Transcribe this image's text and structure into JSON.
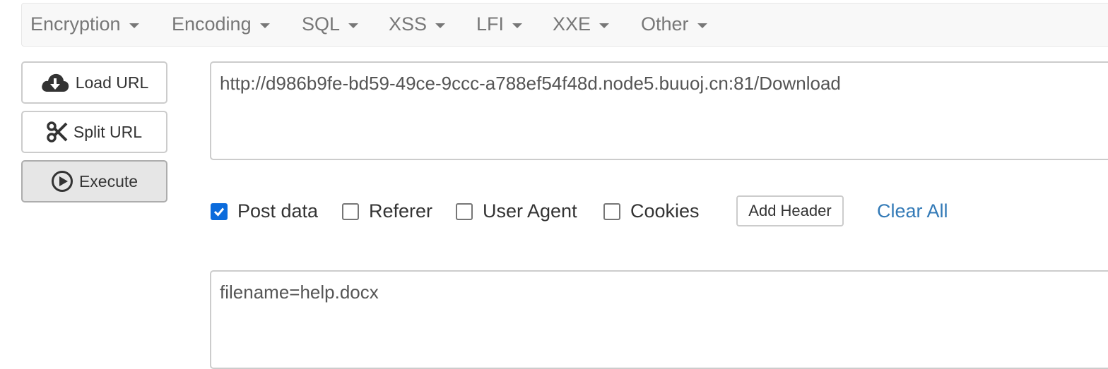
{
  "menu": {
    "items": [
      {
        "label": "Encryption"
      },
      {
        "label": "Encoding"
      },
      {
        "label": "SQL"
      },
      {
        "label": "XSS"
      },
      {
        "label": "LFI"
      },
      {
        "label": "XXE"
      },
      {
        "label": "Other"
      }
    ]
  },
  "sidebar": {
    "load_url_label": "Load URL",
    "split_url_label": "Split URL",
    "execute_label": "Execute"
  },
  "url_input": {
    "value": "http://d986b9fe-bd59-49ce-9ccc-a788ef54f48d.node5.buuoj.cn:81/Download"
  },
  "options": {
    "post_data": {
      "label": "Post data",
      "checked": true
    },
    "referer": {
      "label": "Referer",
      "checked": false
    },
    "user_agent": {
      "label": "User Agent",
      "checked": false
    },
    "cookies": {
      "label": "Cookies",
      "checked": false
    },
    "add_header_label": "Add Header",
    "clear_all_label": "Clear All"
  },
  "post_body": {
    "value": "filename=help.docx"
  },
  "colors": {
    "accent_checkbox": "#0b6bdc",
    "link": "#337ab7"
  }
}
